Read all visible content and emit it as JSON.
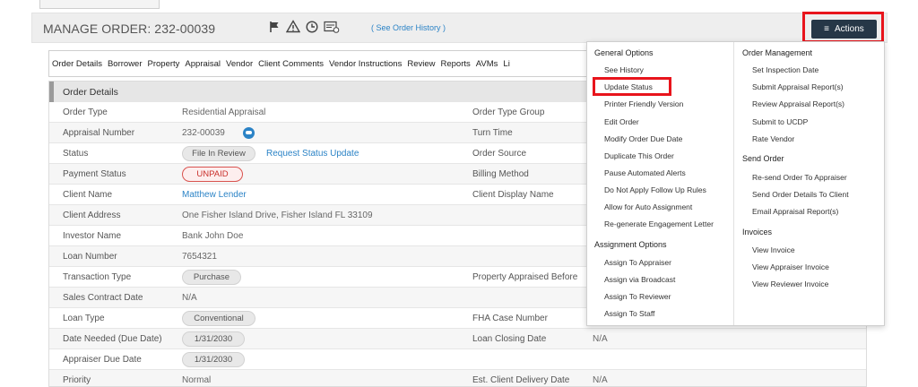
{
  "header": {
    "title": "MANAGE ORDER: 232-00039",
    "history_link": "( See Order History )",
    "actions_label": "Actions"
  },
  "tabs": [
    "Order Details",
    "Borrower",
    "Property",
    "Appraisal",
    "Vendor",
    "Client Comments",
    "Vendor Instructions",
    "Review",
    "Reports",
    "AVMs",
    "Li"
  ],
  "panel": {
    "title": "Order Details",
    "left": [
      {
        "label": "Order Type",
        "value": "Residential Appraisal"
      },
      {
        "label": "Appraisal Number",
        "value": "232-00039"
      },
      {
        "label": "Status",
        "value": "File In Review",
        "link": "Request Status Update"
      },
      {
        "label": "Payment Status",
        "value": "UNPAID"
      },
      {
        "label": "Client Name",
        "value": "Matthew Lender"
      },
      {
        "label": "Client Address",
        "value": "One Fisher Island Drive, Fisher Island FL 33109"
      },
      {
        "label": "Investor Name",
        "value": "Bank John Doe"
      },
      {
        "label": "Loan Number",
        "value": "7654321"
      },
      {
        "label": "Transaction Type",
        "value": "Purchase"
      },
      {
        "label": "Sales Contract Date",
        "value": "N/A"
      },
      {
        "label": "Loan Type",
        "value": "Conventional"
      },
      {
        "label": "Date Needed (Due Date)",
        "value": "1/31/2030"
      },
      {
        "label": "Appraiser Due Date",
        "value": "1/31/2030"
      },
      {
        "label": "Priority",
        "value": "Normal"
      }
    ],
    "right": [
      {
        "label": "Order Type Group",
        "value": ""
      },
      {
        "label": "Turn Time",
        "value": ""
      },
      {
        "label": "Order Source",
        "value": ""
      },
      {
        "label": "Billing Method",
        "value": ""
      },
      {
        "label": "Client Display Name",
        "value": ""
      },
      {
        "label": "",
        "value": ""
      },
      {
        "label": "",
        "value": ""
      },
      {
        "label": "",
        "value": ""
      },
      {
        "label": "Property Appraised Before",
        "value": ""
      },
      {
        "label": "",
        "value": ""
      },
      {
        "label": "FHA Case Number",
        "value": ""
      },
      {
        "label": "Loan Closing Date",
        "value": "N/A"
      },
      {
        "label": "",
        "value": ""
      },
      {
        "label": "Est. Client Delivery Date",
        "value": "N/A"
      }
    ]
  },
  "dropdown": {
    "general_title": "General Options",
    "general": [
      "See History",
      "Update Status",
      "Printer Friendly Version",
      "Edit Order",
      "Modify Order Due Date",
      "Duplicate This Order",
      "Pause Automated Alerts",
      "Do Not Apply Follow Up Rules",
      "Allow for Auto Assignment",
      "Re-generate Engagement Letter"
    ],
    "assignment_title": "Assignment Options",
    "assignment": [
      "Assign To Appraiser",
      "Assign via Broadcast",
      "Assign To Reviewer",
      "Assign To Staff"
    ],
    "order_mgmt_title": "Order Management",
    "order_mgmt": [
      "Set Inspection Date",
      "Submit Appraisal Report(s)",
      "Review Appraisal Report(s)",
      "Submit to UCDP",
      "Rate Vendor"
    ],
    "send_title": "Send Order",
    "send": [
      "Re-send Order To Appraiser",
      "Send Order Details To Client",
      "Email Appraisal Report(s)"
    ],
    "invoices_title": "Invoices",
    "invoices": [
      "View Invoice",
      "View Appraiser Invoice",
      "View Reviewer Invoice"
    ]
  },
  "colors": {
    "accent": "#2b83c6",
    "highlight": "#e8141c",
    "actions_bg": "#263747",
    "unpaid": "#c9302c"
  },
  "icons": [
    "flag-icon",
    "warning-icon",
    "clock-icon",
    "document-icon",
    "menu-icon",
    "bot-icon"
  ]
}
